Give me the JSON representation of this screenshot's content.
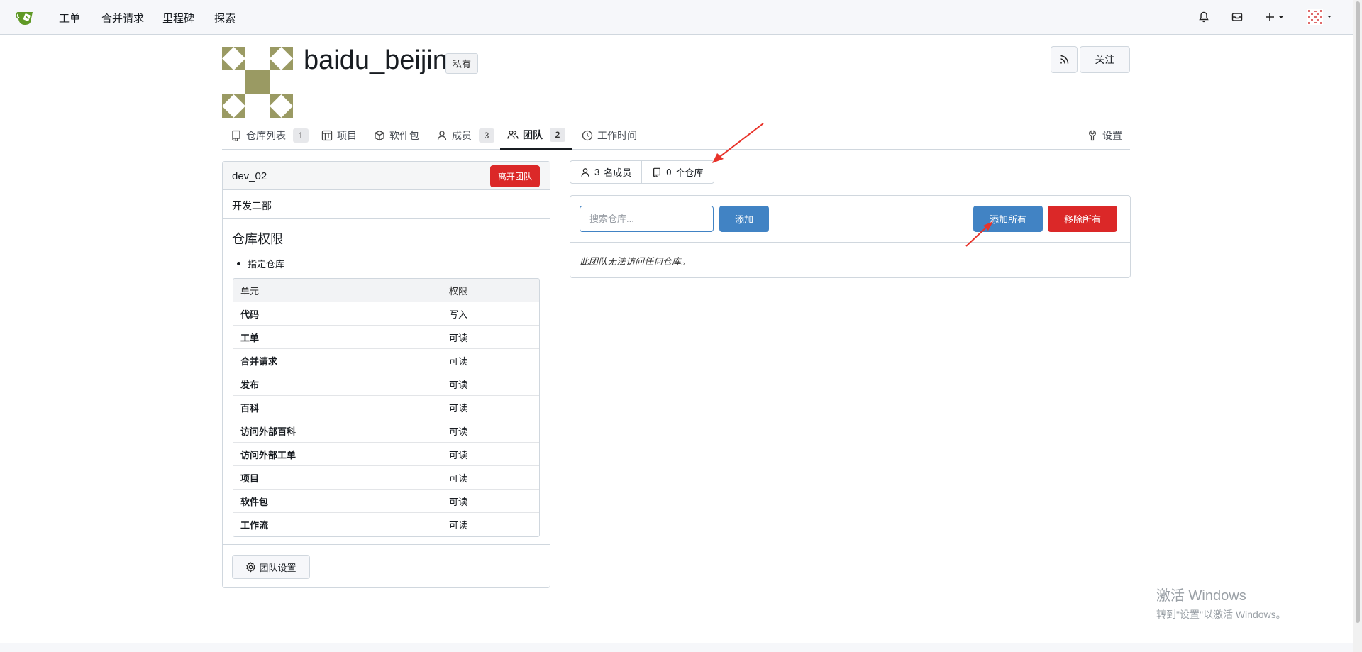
{
  "topnav": {
    "items": [
      "工单",
      "合并请求",
      "里程碑",
      "探索"
    ],
    "icons": [
      "bell-icon",
      "inbox-icon",
      "plus-icon",
      "avatar"
    ]
  },
  "org": {
    "name": "baidu_beijin",
    "visibility": "私有",
    "follow_label": "关注"
  },
  "tabs": [
    {
      "label": "仓库列表",
      "count": "1"
    },
    {
      "label": "项目"
    },
    {
      "label": "软件包"
    },
    {
      "label": "成员",
      "count": "3"
    },
    {
      "label": "团队",
      "count": "2"
    },
    {
      "label": "工作时间"
    },
    {
      "label": "设置"
    }
  ],
  "team": {
    "name": "dev_02",
    "leave_label": "离开团队",
    "description": "开发二部",
    "perm_title": "仓库权限",
    "perm_scope": "指定仓库",
    "table_headers": [
      "单元",
      "权限"
    ],
    "rows": [
      {
        "unit": "代码",
        "perm": "写入"
      },
      {
        "unit": "工单",
        "perm": "可读"
      },
      {
        "unit": "合并请求",
        "perm": "可读"
      },
      {
        "unit": "发布",
        "perm": "可读"
      },
      {
        "unit": "百科",
        "perm": "可读"
      },
      {
        "unit": "访问外部百科",
        "perm": "可读"
      },
      {
        "unit": "访问外部工单",
        "perm": "可读"
      },
      {
        "unit": "项目",
        "perm": "可读"
      },
      {
        "unit": "软件包",
        "perm": "可读"
      },
      {
        "unit": "工作流",
        "perm": "可读"
      }
    ],
    "settings_label": "团队设置"
  },
  "segment": {
    "members_count": "3",
    "members_label": "名成员",
    "repos_count": "0",
    "repos_label": "个仓库"
  },
  "repos": {
    "search_placeholder": "搜索仓库...",
    "add_label": "添加",
    "add_all_label": "添加所有",
    "remove_all_label": "移除所有",
    "empty_message": "此团队无法访问任何仓库。"
  },
  "watermark": {
    "line1": "激活 Windows",
    "line2": "转到\"设置\"以激活 Windows。"
  },
  "colors": {
    "primary": "#4183c4",
    "danger": "#db2828",
    "annotation": "#e8332a",
    "avatar": "#9a9a63"
  }
}
